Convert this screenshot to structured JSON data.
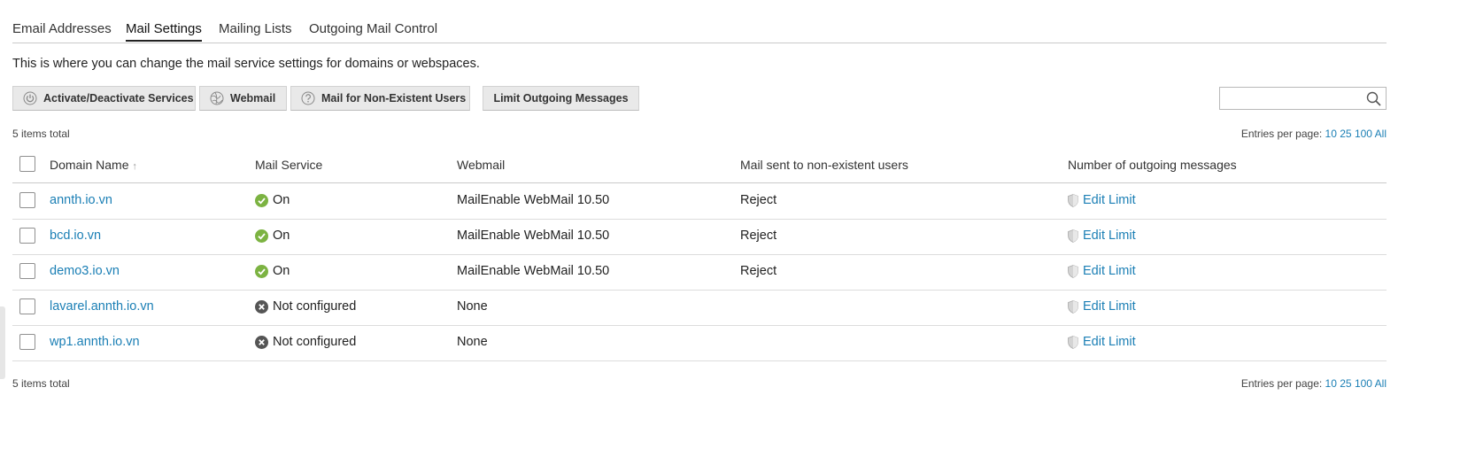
{
  "tabs": [
    {
      "label": "Email Addresses",
      "active": false
    },
    {
      "label": "Mail Settings",
      "active": true
    },
    {
      "label": "Mailing Lists",
      "active": false
    },
    {
      "label": "Outgoing Mail Control",
      "active": false
    }
  ],
  "description": "This is where you can change the mail service settings for domains or webspaces.",
  "toolbar": {
    "activate_label": "Activate/Deactivate Services",
    "webmail_label": "Webmail",
    "nonexistent_label": "Mail for Non-Existent Users",
    "limit_label": "Limit Outgoing Messages"
  },
  "search": {
    "value": "",
    "placeholder": ""
  },
  "summary": {
    "items_total": "5 items total"
  },
  "pagination": {
    "label": "Entries per page:",
    "options": [
      "10",
      "25",
      "100",
      "All"
    ]
  },
  "table": {
    "headers": {
      "domain": "Domain Name",
      "sort_indicator": "↑",
      "mail_service": "Mail Service",
      "webmail": "Webmail",
      "nonexistent": "Mail sent to non-existent users",
      "outgoing": "Number of outgoing messages"
    },
    "rows": [
      {
        "domain": "annth.io.vn",
        "mail_service": "On",
        "webmail": "MailEnable WebMail 10.50",
        "nonexistent": "Reject",
        "outgoing": "Edit Limit"
      },
      {
        "domain": "bcd.io.vn",
        "mail_service": "On",
        "webmail": "MailEnable WebMail 10.50",
        "nonexistent": "Reject",
        "outgoing": "Edit Limit"
      },
      {
        "domain": "demo3.io.vn",
        "mail_service": "On",
        "webmail": "MailEnable WebMail 10.50",
        "nonexistent": "Reject",
        "outgoing": "Edit Limit"
      },
      {
        "domain": "lavarel.annth.io.vn",
        "mail_service": "Not configured",
        "webmail": "None",
        "nonexistent": "",
        "outgoing": "Edit Limit"
      },
      {
        "domain": "wp1.annth.io.vn",
        "mail_service": "Not configured",
        "webmail": "None",
        "nonexistent": "",
        "outgoing": "Edit Limit"
      }
    ]
  },
  "colors": {
    "link": "#1b7fb5",
    "status_on": "#7cb342",
    "status_off": "#555555",
    "button_bg": "#e9e9e9"
  },
  "icons": {
    "activate": "power-icon",
    "webmail": "globe-icon",
    "nonexistent": "question-icon",
    "search": "search-icon",
    "on": "check-circle-icon",
    "off": "x-circle-icon",
    "limit": "shield-icon"
  }
}
